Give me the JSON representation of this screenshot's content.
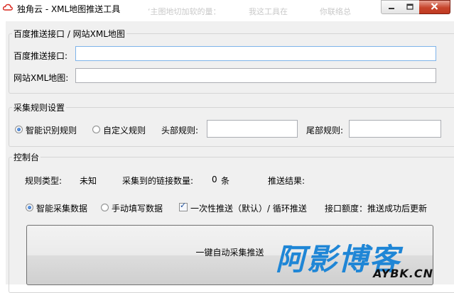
{
  "window": {
    "title": "独角云 - XML地图推送工具",
    "ghost_texts": [
      "‘主图地切加软的量：",
      "我这工具在",
      "你联络总"
    ]
  },
  "baidu_group": {
    "title": "百度推送接口 / 网站XML地图",
    "push_label": "百度推送接口:",
    "push_value": "",
    "sitemap_label": "网站XML地图:",
    "sitemap_value": ""
  },
  "rules_group": {
    "title": "采集规则设置",
    "smart_rule_label": "智能识别规则",
    "custom_rule_label": "自定义规则",
    "head_rule_label": "头部规则:",
    "head_rule_value": "",
    "tail_rule_label": "尾部规则:",
    "tail_rule_value": ""
  },
  "console_group": {
    "title": "控制台",
    "rule_type_label": "规则类型:",
    "rule_type_value": "未知",
    "links_label": "采集到的链接数量:",
    "links_count": "0",
    "links_unit": "条",
    "push_result_label": "推送结果:",
    "smart_collect_label": "智能采集数据",
    "manual_fill_label": "手动填写数据",
    "one_time_push_label": "一次性推送（默认）/ 循环推送",
    "quota_label": "接口额度：推送成功后更新",
    "auto_button_label": "一键自动采集推送"
  },
  "watermark": {
    "cn": "阿影博客",
    "en": "AYBK.CN"
  },
  "colors": {
    "accent": "#1f86d6",
    "close_button": "#c7452c",
    "window_bg": "#f0f0f0"
  }
}
